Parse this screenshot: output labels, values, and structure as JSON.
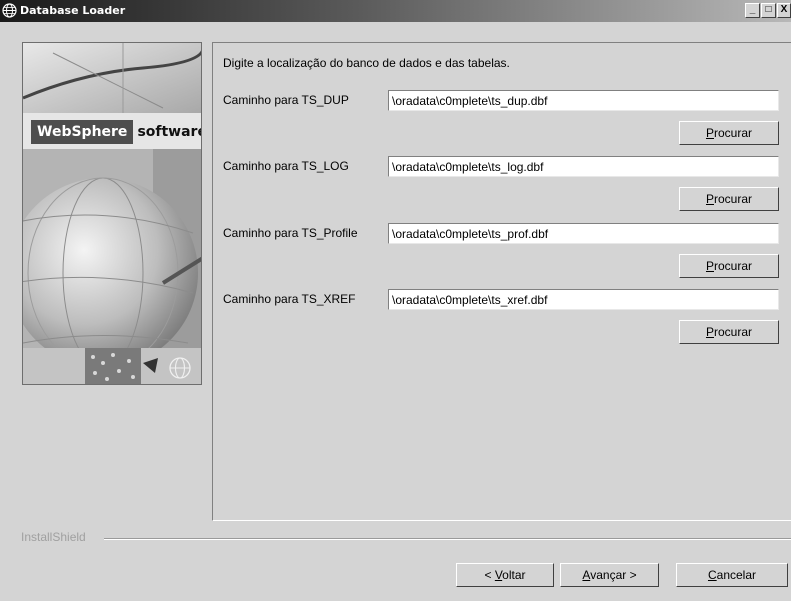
{
  "window": {
    "title": "Database Loader",
    "minimize": "_",
    "maximize": "□",
    "close": "X"
  },
  "branding": {
    "product": "WebSphere",
    "suffix": "software"
  },
  "form": {
    "intro": "Digite a localização do banco de dados e das tabelas.",
    "rows": [
      {
        "label": "Caminho para TS_DUP",
        "value": "\\oradata\\c0mplete\\ts_dup.dbf",
        "browse_mnemonic": "P",
        "browse_rest": "rocurar"
      },
      {
        "label": "Caminho para TS_LOG",
        "value": "\\oradata\\c0mplete\\ts_log.dbf",
        "browse_mnemonic": "P",
        "browse_rest": "rocurar"
      },
      {
        "label": "Caminho para TS_Profile",
        "value": "\\oradata\\c0mplete\\ts_prof.dbf",
        "browse_mnemonic": "P",
        "browse_rest": "rocurar"
      },
      {
        "label": "Caminho para TS_XREF",
        "value": "\\oradata\\c0mplete\\ts_xref.dbf",
        "browse_mnemonic": "P",
        "browse_rest": "rocurar"
      }
    ]
  },
  "footer": {
    "installer": "InstallShield",
    "back": {
      "pre": "< ",
      "mnemonic": "V",
      "rest": "oltar"
    },
    "next": {
      "mnemonic": "A",
      "rest": "vançar >"
    },
    "cancel": {
      "mnemonic": "C",
      "rest": "ancelar"
    }
  },
  "icons": {
    "app": "globe-icon",
    "side_corner": "globe-outline-icon"
  },
  "colors": {
    "window_bg": "#d4d4d4",
    "titlebar_start": "#1a1a1a",
    "titlebar_end": "#b8b8b8",
    "brand_bg": "#4e4e4e"
  }
}
